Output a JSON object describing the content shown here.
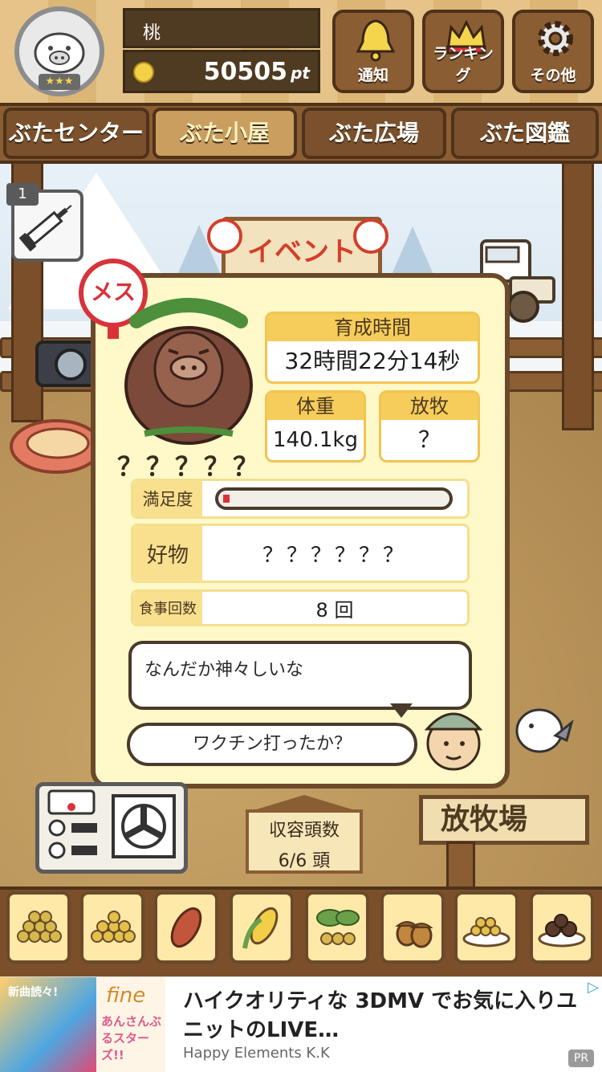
{
  "header": {
    "player_name": "桃",
    "points": "50505",
    "points_unit": "pt",
    "rank_stars": 3,
    "buttons": {
      "notify": "通知",
      "ranking": "ランキング",
      "other": "その他"
    }
  },
  "nav": {
    "tabs": [
      "ぶたセンター",
      "ぶた小屋",
      "ぶた広場",
      "ぶた図鑑"
    ],
    "active": "ぶた小屋"
  },
  "scene": {
    "event_sign": "イベント",
    "syringe_count": "1"
  },
  "pig_card": {
    "gender_label": "メス",
    "name": "？？？？？",
    "raising_time_label": "育成時間",
    "raising_time": "32時間22分14秒",
    "weight_label": "体重",
    "weight": "140.1kg",
    "grazing_label": "放牧",
    "grazing": "？",
    "satisfaction_label": "満足度",
    "satisfaction_level": 0.03,
    "favorite_label": "好物",
    "favorite": "？？？？？？",
    "meals_label": "食事回数",
    "meals": "8 回",
    "pig_speech": "なんだか神々しいな",
    "farmer_speech": "ワクチン打ったか？"
  },
  "bottom": {
    "capacity_label": "収容頭数",
    "capacity_value": "6/6 頭",
    "pasture_sign": "放牧場",
    "foods": [
      "beans-icon",
      "corn-kernels-icon",
      "sweet-potato-icon",
      "corn-cob-icon",
      "leaf-berries-icon",
      "acorn-icon",
      "grain-plate-icon",
      "chestnut-plate-icon"
    ]
  },
  "ad": {
    "title": "ハイクオリティな 3DMV でお気に入りユニットのLIVE…",
    "advertiser": "Happy Elements K.K",
    "pr_label": "PR",
    "image_text": "新曲読々!",
    "logo_text": "fine",
    "game_logo": "あんさんぶるスターズ!!"
  },
  "colors": {
    "female": "#d8323a",
    "panel_bg": "#fff8c9",
    "accent_yellow": "#f6cd5a",
    "wood_dark": "#4f321a"
  }
}
